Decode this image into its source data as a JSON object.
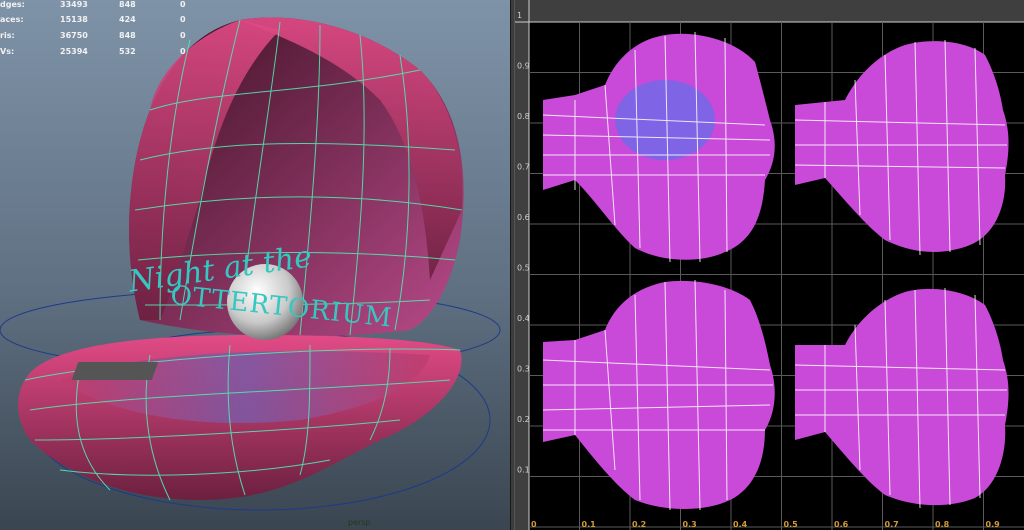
{
  "viewport": {
    "camera_label": "persp",
    "hud": [
      {
        "label": "dges:",
        "c1": "33493",
        "c2": "848",
        "c3": "0"
      },
      {
        "label": "aces:",
        "c1": "15138",
        "c2": "424",
        "c3": "0"
      },
      {
        "label": "ris:",
        "c1": "36750",
        "c2": "848",
        "c3": "0"
      },
      {
        "label": "Vs:",
        "c1": "25394",
        "c2": "532",
        "c3": "0"
      }
    ],
    "title_line1": "Night at the",
    "title_line2": "OTTERTORIUM"
  },
  "uv_editor": {
    "u_ticks": [
      "0",
      "0.1",
      "0.2",
      "0.3",
      "0.4",
      "0.5",
      "0.6",
      "0.7",
      "0.8",
      "0.9"
    ],
    "v_ticks": [
      "1",
      "0.9",
      "0.8",
      "0.7",
      "0.6",
      "0.5",
      "0.4",
      "0.3",
      "0.2",
      "0.1"
    ]
  },
  "colors": {
    "shell_pink": "#d8457c",
    "wire_green": "#50e8b0",
    "uv_magenta": "#d84fd8",
    "grid_line": "#5a5a5a",
    "title_teal": "#36c7c0"
  }
}
